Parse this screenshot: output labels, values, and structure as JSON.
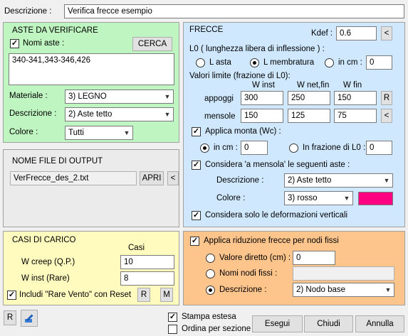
{
  "descrizione": {
    "label": "Descrizione :",
    "value": "Verifica frecce esempio"
  },
  "aste": {
    "title": "ASTE DA VERIFICARE",
    "nomi_checked": true,
    "nomi_label": "Nomi aste :",
    "cerca_label": "CERCA",
    "aste_text": "340-341,343-346,426",
    "materiale_label": "Materiale :",
    "materiale_value": "3) LEGNO",
    "descrizione_label": "Descrizione :",
    "descrizione_value": "2) Aste tetto",
    "colore_label": "Colore :",
    "colore_value": "Tutti"
  },
  "output": {
    "title": "NOME FILE DI OUTPUT",
    "file": "VerFrecce_des_2.txt",
    "apri_label": "APRI",
    "back_label": "<"
  },
  "frecce": {
    "title": "FRECCE",
    "kdef_label": "Kdef :",
    "kdef_value": "0.6",
    "kdef_btn": "<",
    "l0_label": "L0 ( lunghezza libera di inflessione ) :",
    "l_asta": "L asta",
    "l_membratura": "L membratura",
    "in_cm": "in cm :",
    "in_cm_value": "0",
    "valori_label": "Valori limite (frazione di L0):",
    "col_winst": "W inst",
    "col_wnetfin": "W net,fin",
    "col_wfin": "W fin",
    "appoggi_label": "appoggi",
    "appoggi": [
      "300",
      "250",
      "150"
    ],
    "r_btn": "R",
    "mensole_label": "mensole",
    "mensole": [
      "150",
      "125",
      "75"
    ],
    "mensole_btn": "<",
    "monta_label": "Applica monta (Wc) :",
    "monta_checked": true,
    "monta_cm_label": "in cm :",
    "monta_cm_value": "0",
    "monta_frazione_label": "In frazione di  L0 :",
    "monta_frazione_value": "0",
    "mensola_label": "Considera 'a mensola' le seguenti aste :",
    "mensola_checked": true,
    "mensola_desc_label": "Descrizione :",
    "mensola_desc_value": "2) Aste tetto",
    "mensola_colore_label": "Colore :",
    "mensola_colore_value": "3) rosso",
    "mensola_colore_swatch": "#ff0080",
    "verticali_label": "Considera solo le deformazioni verticali",
    "verticali_checked": true
  },
  "casi": {
    "title": "CASI DI CARICO",
    "col_casi": "Casi",
    "wcreep_label": "W creep (Q.P.)",
    "wcreep_value": "10",
    "winst_label": "W inst   (Rare)",
    "winst_value": "8",
    "rare_vento_label": "Includi \"Rare Vento\" con Reset",
    "rare_vento_checked": true,
    "r_btn": "R",
    "m_btn": "M"
  },
  "riduzione": {
    "title": "Applica riduzione frecce per nodi fissi",
    "checked": true,
    "valore_label": "Valore diretto (cm) :",
    "valore_value": "0",
    "nomi_label": "Nomi nodi fissi :",
    "nomi_value": "",
    "descrizione_label": "Descrizione :",
    "descrizione_value": "2) Nodo base"
  },
  "bottom": {
    "r_btn": "R",
    "stampa_label": "Stampa estesa",
    "stampa_checked": true,
    "ordina_label": "Ordina per sezione",
    "ordina_checked": false,
    "esegui": "Esegui",
    "chiudi": "Chiudi",
    "annulla": "Annulla"
  }
}
